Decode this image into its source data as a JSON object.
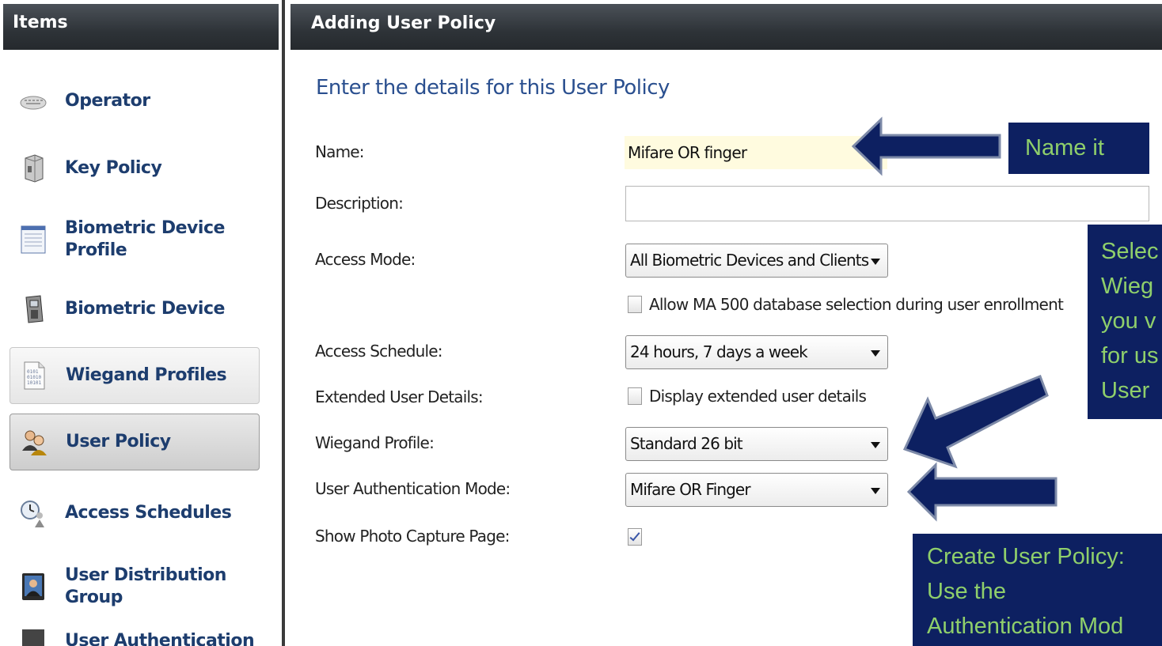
{
  "sidebar": {
    "header": "Items",
    "items": [
      {
        "label": "Operator",
        "icon": "keyboard-icon",
        "state": "plain"
      },
      {
        "label": "Key Policy",
        "icon": "server-icon",
        "state": "plain"
      },
      {
        "label": "Biometric Device Profile",
        "icon": "document-icon",
        "state": "plain"
      },
      {
        "label": "Biometric Device",
        "icon": "reader-device-icon",
        "state": "plain"
      },
      {
        "label": "Wiegand Profiles",
        "icon": "binary-file-icon",
        "state": "boxed"
      },
      {
        "label": "User Policy",
        "icon": "users-icon",
        "state": "selected"
      },
      {
        "label": "Access Schedules",
        "icon": "clock-user-icon",
        "state": "plain"
      },
      {
        "label": "User Distribution Group",
        "icon": "user-portrait-icon",
        "state": "plain"
      },
      {
        "label": "User Authentication",
        "icon": "auth-icon",
        "state": "plain"
      }
    ]
  },
  "main": {
    "header": "Adding User Policy",
    "intro": "Enter the details for this User Policy",
    "form": {
      "name_label": "Name:",
      "name_value": "Mifare OR finger",
      "description_label": "Description:",
      "description_value": "",
      "access_mode_label": "Access Mode:",
      "access_mode_value": "All Biometric Devices and Clients",
      "allow_ma500_label": "Allow MA 500 database selection during user enrollment",
      "allow_ma500_checked": false,
      "access_schedule_label": "Access Schedule:",
      "access_schedule_value": "24 hours, 7 days a week",
      "extended_label": "Extended User Details:",
      "extended_checkbox_label": "Display extended user details",
      "extended_checked": false,
      "wiegand_label": "Wiegand Profile:",
      "wiegand_value": "Standard 26 bit",
      "auth_mode_label": "User Authentication Mode:",
      "auth_mode_value": "Mifare OR Finger",
      "photo_label": "Show Photo Capture Page:",
      "photo_checked": true
    }
  },
  "annotations": {
    "name_it": "Name it",
    "select_wiegand": [
      "Selec",
      "Wieg",
      "you v",
      "for us",
      "User"
    ],
    "create_policy": [
      "Create User Policy:",
      "Use the",
      "Authentication Mod"
    ]
  },
  "colors": {
    "header_bg": "#2e3338",
    "link_blue": "#1d3d6e",
    "callout_bg": "#0d2061",
    "callout_text": "#8fcf6b",
    "arrow_fill": "#0d2061",
    "name_input_bg": "#fffbdf"
  }
}
